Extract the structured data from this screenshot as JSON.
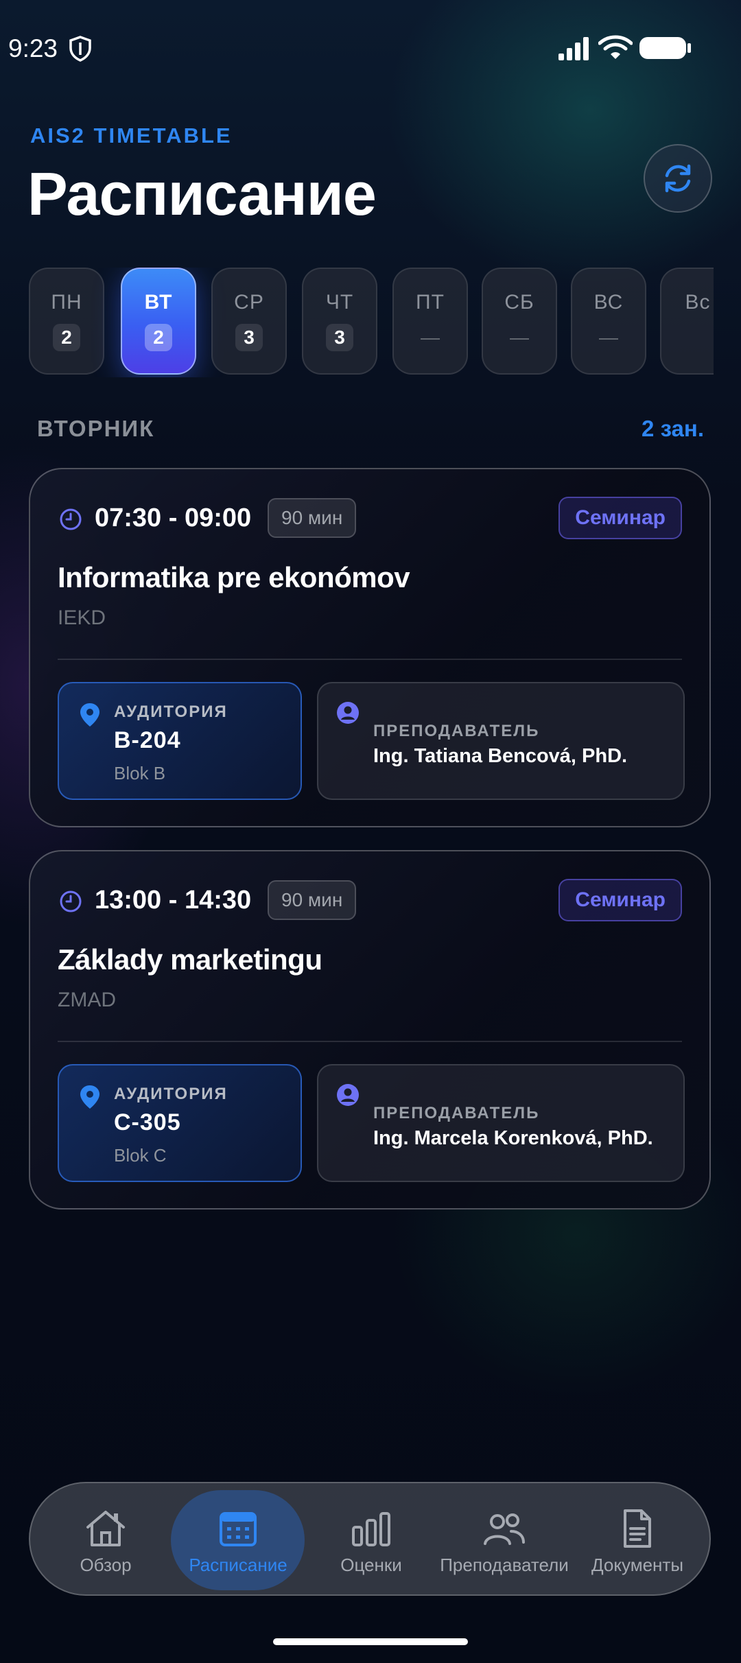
{
  "status_bar": {
    "time": "9:23"
  },
  "header": {
    "app_label": "AIS2 TIMETABLE",
    "title": "Расписание"
  },
  "days": [
    {
      "name": "ПН",
      "count": "2"
    },
    {
      "name": "ВТ",
      "count": "2"
    },
    {
      "name": "СР",
      "count": "3"
    },
    {
      "name": "ЧТ",
      "count": "3"
    },
    {
      "name": "ПТ",
      "count": "—"
    },
    {
      "name": "СБ",
      "count": "—"
    },
    {
      "name": "ВС",
      "count": "—"
    },
    {
      "name": "Вс",
      "count": ""
    }
  ],
  "selected_day": "ВТ",
  "section": {
    "title": "ВТОРНИК",
    "count": "2 зан."
  },
  "lessons": [
    {
      "time": "07:30 - 09:00",
      "duration": "90 мин",
      "type": "Семинар",
      "course": "Informatika pre ekonómov",
      "code": "IEKD",
      "room_label": "АУДИТОРИЯ",
      "room": "B-204",
      "building": "Blok B",
      "teacher_label": "ПРЕПОДАВАТЕЛЬ",
      "teacher": "Ing. Tatiana Bencová, PhD."
    },
    {
      "time": "13:00 - 14:30",
      "duration": "90 мин",
      "type": "Семинар",
      "course": "Základy marketingu",
      "code": "ZMAD",
      "room_label": "АУДИТОРИЯ",
      "room": "C-305",
      "building": "Blok C",
      "teacher_label": "ПРЕПОДАВАТЕЛЬ",
      "teacher": "Ing. Marcela Korenková, PhD."
    }
  ],
  "nav": [
    {
      "label": "Обзор",
      "icon": "home-icon"
    },
    {
      "label": "Расписание",
      "icon": "calendar-icon"
    },
    {
      "label": "Оценки",
      "icon": "bar-chart-icon"
    },
    {
      "label": "Преподаватели",
      "icon": "people-icon"
    },
    {
      "label": "Документы",
      "icon": "document-icon"
    }
  ],
  "colors": {
    "accent": "#2f86f2",
    "active_day_gradient": [
      "#3d8bf7",
      "#4d3fe6"
    ],
    "seminar_badge": "#6e72f5",
    "background": "#050a16"
  }
}
